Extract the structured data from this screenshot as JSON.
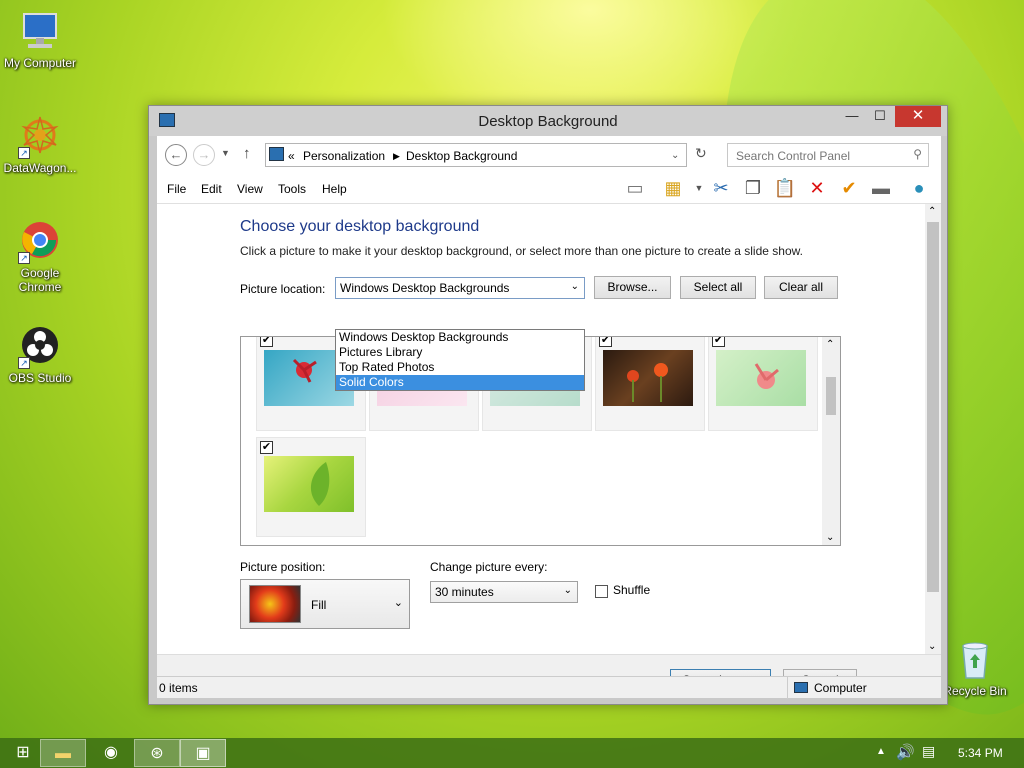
{
  "desktop": {
    "icons": [
      {
        "label": "My Computer"
      },
      {
        "label": "DataWagon..."
      },
      {
        "label": "Google Chrome"
      },
      {
        "label": "OBS Studio"
      },
      {
        "label": "Recycle Bin"
      }
    ]
  },
  "window": {
    "title": "Desktop Background",
    "controls": {
      "minimize": "—",
      "maximize": "☐",
      "close": "✕"
    },
    "address": {
      "chevrons": "«",
      "crumbs": [
        "Personalization",
        "Desktop Background"
      ],
      "search_placeholder": "Search Control Panel"
    },
    "menu": [
      "File",
      "Edit",
      "View",
      "Tools",
      "Help"
    ],
    "heading": "Choose your desktop background",
    "subtitle": "Click a picture to make it your desktop background, or select more than one picture to create a slide show.",
    "picture_location": {
      "label": "Picture location:",
      "selected": "Windows Desktop Backgrounds",
      "options": [
        "Windows Desktop Backgrounds",
        "Pictures Library",
        "Top Rated Photos",
        "Solid Colors"
      ],
      "highlighted": "Solid Colors"
    },
    "buttons": {
      "browse": "Browse...",
      "select_all": "Select all",
      "clear_all": "Clear all",
      "save": "Save changes",
      "cancel": "Cancel"
    },
    "picture_position": {
      "label": "Picture position:",
      "value": "Fill"
    },
    "change_every": {
      "label": "Change picture every:",
      "value": "30 minutes"
    },
    "shuffle": {
      "label": "Shuffle",
      "checked": false
    },
    "status": {
      "items": "0 items",
      "location": "Computer"
    }
  },
  "taskbar": {
    "time": "5:34 PM"
  }
}
